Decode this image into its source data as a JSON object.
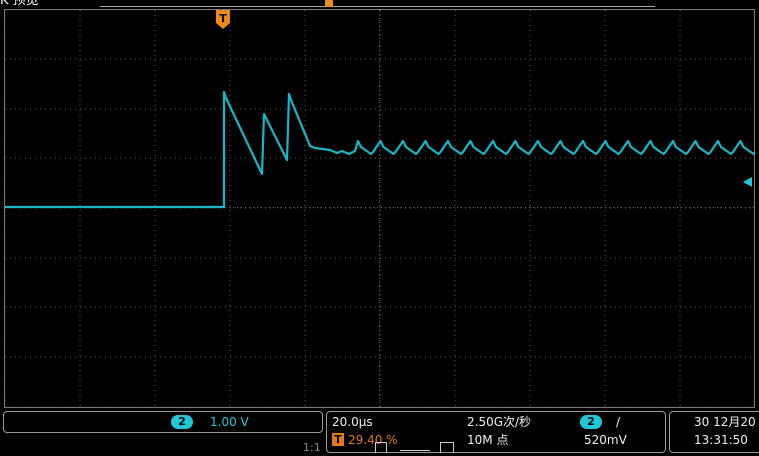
{
  "top_bar": {
    "mode_label": "K 预览",
    "trigger_marker": "T"
  },
  "waveform": {
    "channel": "2",
    "color": "#1fc8d8",
    "trace_color": "#16b8c8"
  },
  "bottom_bar": {
    "channel_panel": {
      "badge": "2",
      "scale": "1.00 V"
    },
    "timebase_panel": {
      "time_per_div": "20.0μs",
      "sample_rate": "2.50G次/秒",
      "trigger_badge": "2",
      "trigger_slope": "/",
      "trigger_marker": "T",
      "trigger_offset": "29.40 %",
      "memory_depth": "10M 点",
      "trigger_level": "520mV"
    },
    "datetime_panel": {
      "date": "30 12月20",
      "time": "13:31:50"
    },
    "ratio_label": "1:1"
  },
  "colors": {
    "grid_dot": "#5a5a5a",
    "grid_border": "#7d7d7d",
    "accent_orange": "#f08a1c",
    "cyan": "#1fc8d8"
  }
}
